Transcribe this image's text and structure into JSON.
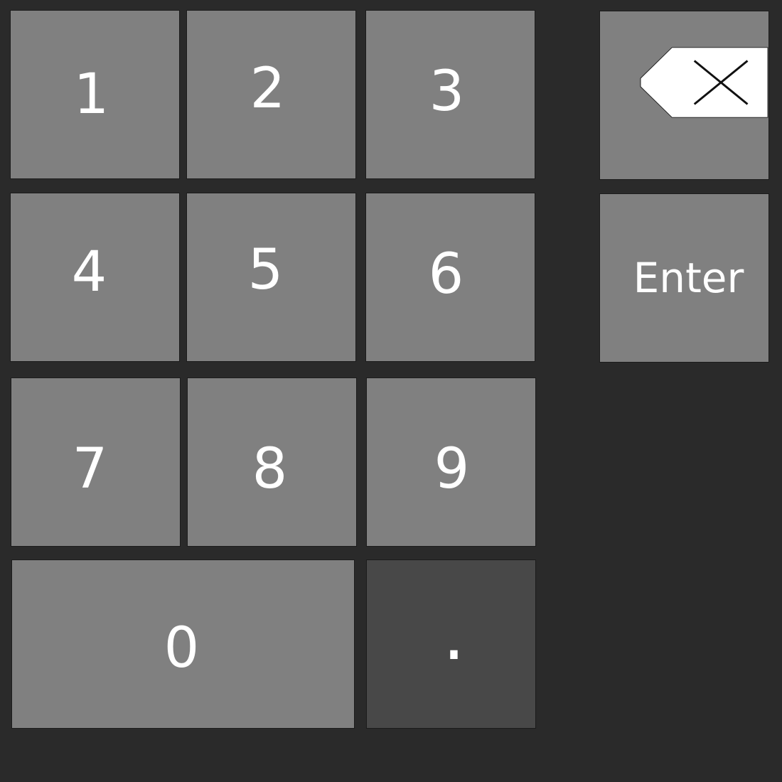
{
  "keypad": {
    "keys": {
      "one": "1",
      "two": "2",
      "three": "3",
      "four": "4",
      "five": "5",
      "six": "6",
      "seven": "7",
      "eight": "8",
      "nine": "9",
      "zero": "0",
      "decimal": "."
    },
    "backspace_icon": "backspace-icon",
    "enter_label": "Enter"
  },
  "colors": {
    "background": "#2a2a2a",
    "key": "#808080",
    "key_disabled": "#484848",
    "text": "#ffffff"
  }
}
